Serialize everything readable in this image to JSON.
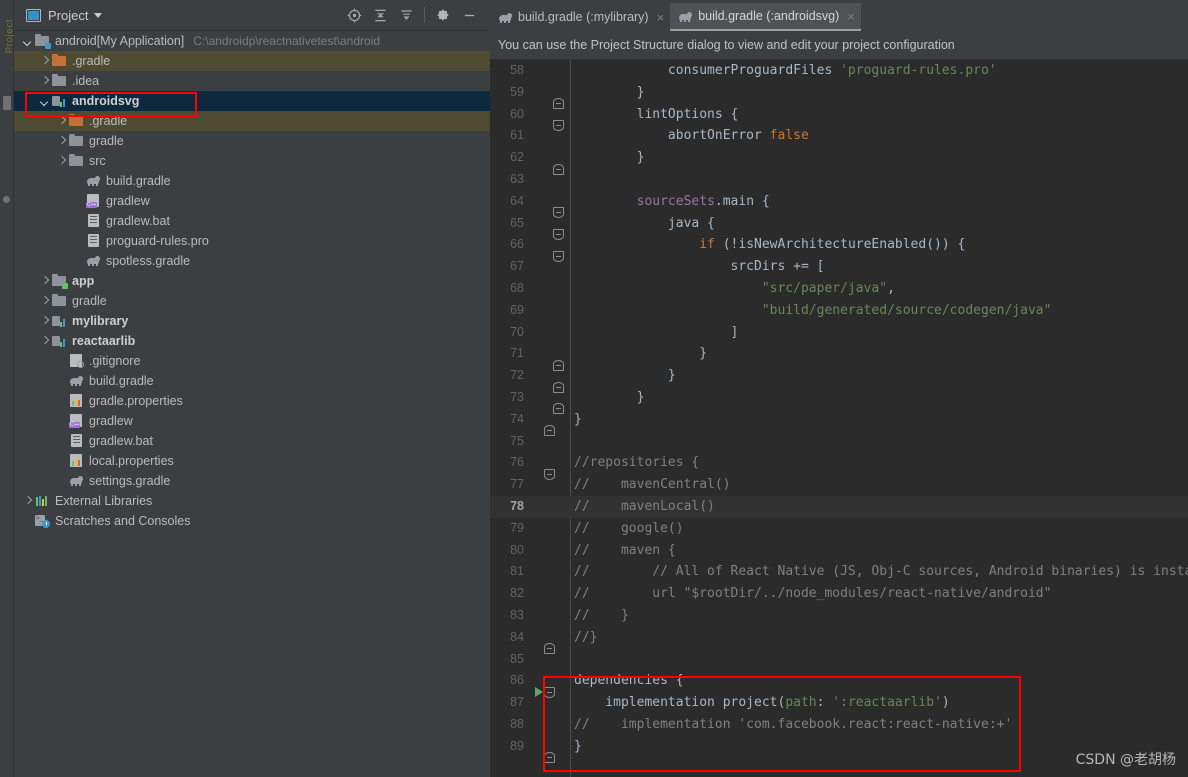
{
  "window": {
    "left_strip_label": "Project"
  },
  "project_panel": {
    "title": "Project",
    "icons": {
      "locate": "crosshair-target-icon",
      "expand_all": "expand-all-icon",
      "collapse_all": "collapse-all-icon",
      "settings": "gear-icon",
      "hide": "minimize-icon"
    },
    "tree": [
      {
        "label": "android",
        "bracket": "[My Application]",
        "path": "C:\\androidp\\reactnativetest\\android",
        "indent": 0,
        "arrow": "down",
        "icon": "module-folder-icon",
        "bold": false,
        "state": "normal"
      },
      {
        "label": ".gradle",
        "indent": 1,
        "arrow": "right",
        "icon": "folder-orange-icon",
        "bold": false,
        "state": "highlight"
      },
      {
        "label": ".idea",
        "indent": 1,
        "arrow": "right",
        "icon": "folder-grey-icon",
        "bold": false,
        "state": "normal"
      },
      {
        "label": "androidsvg",
        "indent": 1,
        "arrow": "down",
        "icon": "module-icon",
        "bold": true,
        "state": "selected"
      },
      {
        "label": ".gradle",
        "indent": 2,
        "arrow": "right",
        "icon": "folder-orange-icon",
        "bold": false,
        "state": "highlight"
      },
      {
        "label": "gradle",
        "indent": 2,
        "arrow": "right",
        "icon": "folder-grey-icon",
        "bold": false,
        "state": "normal"
      },
      {
        "label": "src",
        "indent": 2,
        "arrow": "right",
        "icon": "folder-grey-icon",
        "bold": false,
        "state": "normal"
      },
      {
        "label": "build.gradle",
        "indent": 3,
        "arrow": "none",
        "icon": "gradle-file-icon",
        "bold": false,
        "state": "normal"
      },
      {
        "label": "gradlew",
        "indent": 3,
        "arrow": "none",
        "icon": "cpp-file-icon",
        "bold": false,
        "state": "normal"
      },
      {
        "label": "gradlew.bat",
        "indent": 3,
        "arrow": "none",
        "icon": "text-file-icon",
        "bold": false,
        "state": "normal"
      },
      {
        "label": "proguard-rules.pro",
        "indent": 3,
        "arrow": "none",
        "icon": "text-file-icon",
        "bold": false,
        "state": "normal"
      },
      {
        "label": "spotless.gradle",
        "indent": 3,
        "arrow": "none",
        "icon": "gradle-file-icon",
        "bold": false,
        "state": "normal"
      },
      {
        "label": "app",
        "indent": 1,
        "arrow": "right",
        "icon": "folder-module-green-icon",
        "bold": true,
        "state": "normal"
      },
      {
        "label": "gradle",
        "indent": 1,
        "arrow": "right",
        "icon": "folder-grey-icon",
        "bold": false,
        "state": "normal"
      },
      {
        "label": "mylibrary",
        "indent": 1,
        "arrow": "right",
        "icon": "module-icon",
        "bold": true,
        "state": "normal"
      },
      {
        "label": "reactaarlib",
        "indent": 1,
        "arrow": "right",
        "icon": "module-icon",
        "bold": true,
        "state": "normal"
      },
      {
        "label": ".gitignore",
        "indent": 2,
        "arrow": "none",
        "icon": "gitignore-file-icon",
        "bold": false,
        "state": "normal"
      },
      {
        "label": "build.gradle",
        "indent": 2,
        "arrow": "none",
        "icon": "gradle-file-icon",
        "bold": false,
        "state": "normal"
      },
      {
        "label": "gradle.properties",
        "indent": 2,
        "arrow": "none",
        "icon": "properties-file-icon",
        "bold": false,
        "state": "normal"
      },
      {
        "label": "gradlew",
        "indent": 2,
        "arrow": "none",
        "icon": "cpp-file-icon",
        "bold": false,
        "state": "normal"
      },
      {
        "label": "gradlew.bat",
        "indent": 2,
        "arrow": "none",
        "icon": "text-file-icon",
        "bold": false,
        "state": "normal"
      },
      {
        "label": "local.properties",
        "indent": 2,
        "arrow": "none",
        "icon": "properties-file-icon",
        "bold": false,
        "state": "normal"
      },
      {
        "label": "settings.gradle",
        "indent": 2,
        "arrow": "none",
        "icon": "gradle-file-icon",
        "bold": false,
        "state": "normal"
      },
      {
        "label": "External Libraries",
        "indent": 0,
        "arrow": "right",
        "icon": "libraries-icon",
        "bold": false,
        "state": "normal"
      },
      {
        "label": "Scratches and Consoles",
        "indent": 0,
        "arrow": "none",
        "icon": "scratches-icon",
        "bold": false,
        "state": "normal"
      }
    ]
  },
  "editor": {
    "tabs": [
      {
        "label": "build.gradle (:mylibrary)",
        "active": false,
        "icon": "gradle-file-icon",
        "close": "×"
      },
      {
        "label": "build.gradle (:androidsvg)",
        "active": true,
        "icon": "gradle-file-icon",
        "close": "×"
      }
    ],
    "notice": "You can use the Project Structure dialog to view and edit your project configuration",
    "current_line": 78,
    "lines": [
      {
        "n": 58,
        "fold": "none",
        "run": false,
        "html": "            consumerProguardFiles <span class=\"s-str\">'proguard-rules.pro'</span>"
      },
      {
        "n": 59,
        "fold": "open",
        "run": false,
        "html": "        }"
      },
      {
        "n": 60,
        "fold": "coll",
        "run": false,
        "html": "        lintOptions {"
      },
      {
        "n": 61,
        "fold": "none",
        "run": false,
        "html": "            abortOnError <span class=\"s-kw\">false</span>"
      },
      {
        "n": 62,
        "fold": "open",
        "run": false,
        "html": "        }"
      },
      {
        "n": 63,
        "fold": "none",
        "run": false,
        "html": ""
      },
      {
        "n": 64,
        "fold": "coll",
        "run": false,
        "html": "        <span class=\"s-prop\">sourceSets</span>.main {"
      },
      {
        "n": 65,
        "fold": "coll",
        "run": false,
        "html": "            java {"
      },
      {
        "n": 66,
        "fold": "coll",
        "run": false,
        "html": "                <span class=\"s-kw\">if</span> (!isNewArchitectureEnabled()) {"
      },
      {
        "n": 67,
        "fold": "none",
        "run": false,
        "html": "                    srcDirs += ["
      },
      {
        "n": 68,
        "fold": "none",
        "run": false,
        "html": "                        <span class=\"s-str\">\"src/paper/java\"</span>,"
      },
      {
        "n": 69,
        "fold": "none",
        "run": false,
        "html": "                        <span class=\"s-str\">\"build/generated/source/codegen/java\"</span>"
      },
      {
        "n": 70,
        "fold": "none",
        "run": false,
        "html": "                    ]"
      },
      {
        "n": 71,
        "fold": "open",
        "run": false,
        "html": "                }"
      },
      {
        "n": 72,
        "fold": "open",
        "run": false,
        "html": "            }"
      },
      {
        "n": 73,
        "fold": "open",
        "run": false,
        "html": "        }"
      },
      {
        "n": 74,
        "fold": "open0",
        "run": false,
        "html": "}"
      },
      {
        "n": 75,
        "fold": "none",
        "run": false,
        "html": ""
      },
      {
        "n": 76,
        "fold": "coll0",
        "run": false,
        "html": "<span class=\"s-cmt\">//repositories {</span>"
      },
      {
        "n": 77,
        "fold": "none",
        "run": false,
        "html": "<span class=\"s-cmt\">//    mavenCentral()</span>"
      },
      {
        "n": 78,
        "fold": "none",
        "run": false,
        "html": "<span class=\"s-cmt\">//    mavenLocal()</span>"
      },
      {
        "n": 79,
        "fold": "none",
        "run": false,
        "html": "<span class=\"s-cmt\">//    google()</span>"
      },
      {
        "n": 80,
        "fold": "none",
        "run": false,
        "html": "<span class=\"s-cmt\">//    maven {</span>"
      },
      {
        "n": 81,
        "fold": "none",
        "run": false,
        "html": "<span class=\"s-cmt\">//        // All of React Native (JS, Obj-C sources, Android binaries) is instal</span>"
      },
      {
        "n": 82,
        "fold": "none",
        "run": false,
        "html": "<span class=\"s-cmt\">//        url \"$rootDir/../node_modules/react-native/android\"</span>"
      },
      {
        "n": 83,
        "fold": "none",
        "run": false,
        "html": "<span class=\"s-cmt\">//    }</span>"
      },
      {
        "n": 84,
        "fold": "open0",
        "run": false,
        "html": "<span class=\"s-cmt\">//}</span>"
      },
      {
        "n": 85,
        "fold": "none",
        "run": false,
        "html": ""
      },
      {
        "n": 86,
        "fold": "coll0",
        "run": true,
        "html": "dependencies {"
      },
      {
        "n": 87,
        "fold": "none",
        "run": false,
        "html": "    implementation project(<span class=\"s-lbl\">path</span>: <span class=\"s-str\">':reactaarlib'</span>)"
      },
      {
        "n": 88,
        "fold": "none",
        "run": false,
        "html": "<span class=\"s-cmt\">//    implementation 'com.facebook.react:react-native:+'</span>"
      },
      {
        "n": 89,
        "fold": "open0",
        "run": false,
        "html": "}"
      }
    ]
  },
  "annotations": {
    "red_box_tree_label": "androidsvg-highlight-box",
    "red_box_code_label": "dependencies-block-highlight-box",
    "accent_red": "#ff0000"
  },
  "watermark": "CSDN @老胡杨"
}
